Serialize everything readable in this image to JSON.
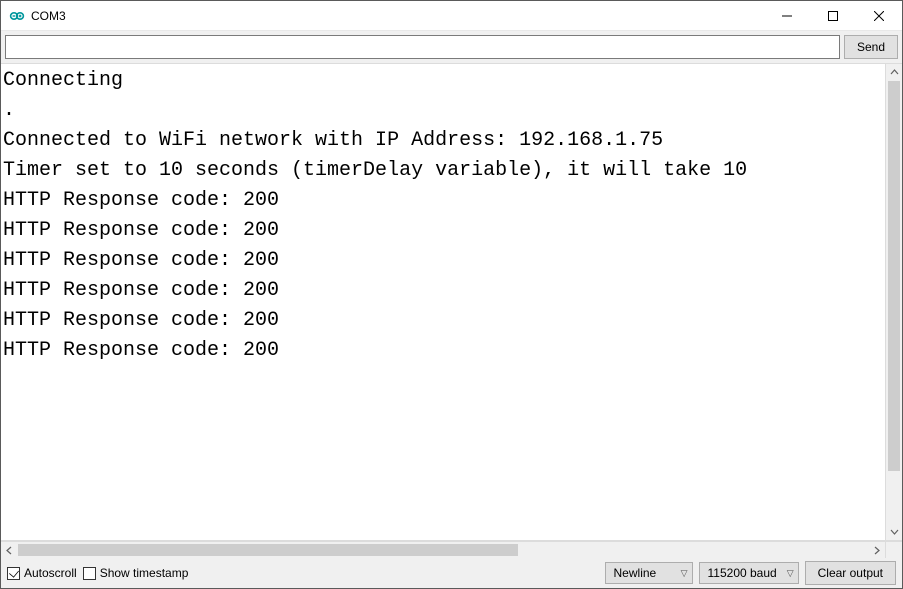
{
  "window": {
    "title": "COM3"
  },
  "toolbar": {
    "input_value": "",
    "input_placeholder": "",
    "send_label": "Send"
  },
  "console": {
    "lines": [
      "Connecting",
      ".",
      "Connected to WiFi network with IP Address: 192.168.1.75",
      "Timer set to 10 seconds (timerDelay variable), it will take 10",
      "HTTP Response code: 200",
      "HTTP Response code: 200",
      "HTTP Response code: 200",
      "HTTP Response code: 200",
      "HTTP Response code: 200",
      "HTTP Response code: 200"
    ]
  },
  "footer": {
    "autoscroll_label": "Autoscroll",
    "autoscroll_checked": true,
    "timestamp_label": "Show timestamp",
    "timestamp_checked": false,
    "line_ending": {
      "selected": "Newline"
    },
    "baud": {
      "selected": "115200 baud"
    },
    "clear_label": "Clear output"
  }
}
